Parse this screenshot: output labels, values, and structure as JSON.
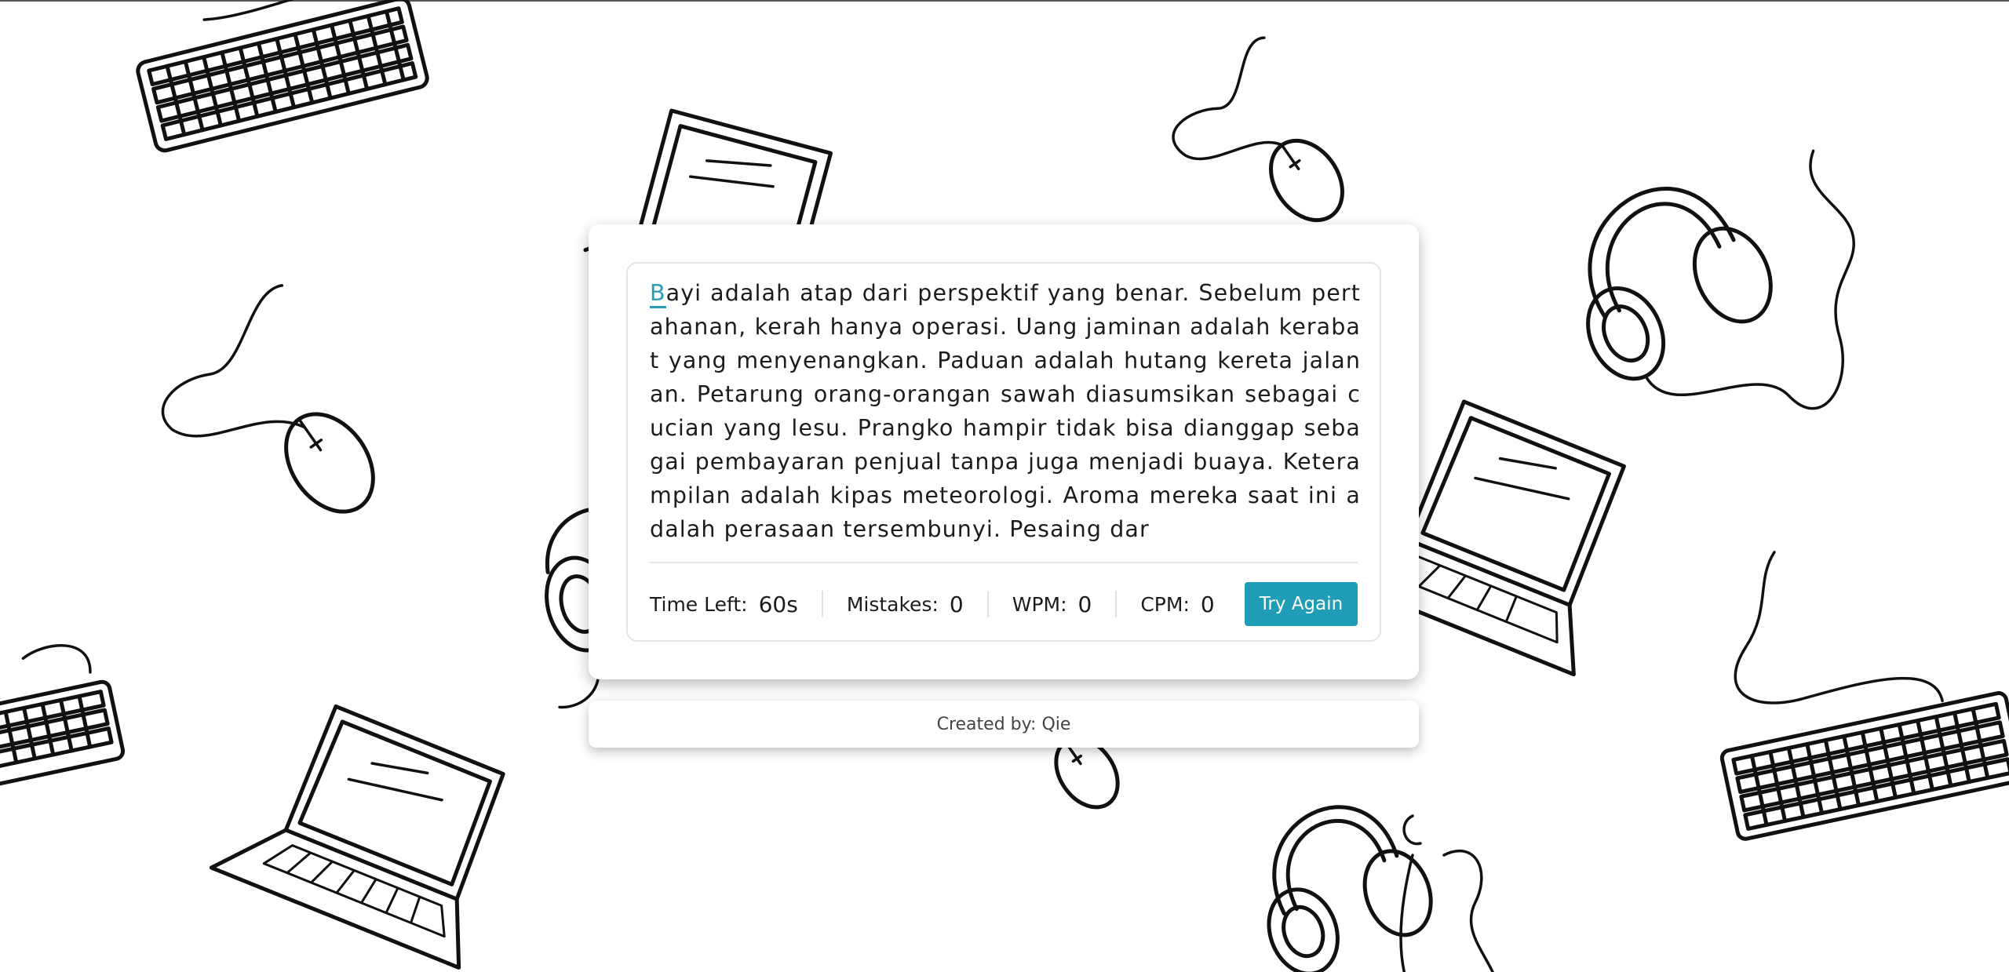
{
  "typing": {
    "active_char": "B",
    "text_rest": "ayi adalah atap dari perspektif yang benar. Sebelum pertahanan, kerah hanya operasi. Uang jaminan adalah kerabat yang menyenangkan. Paduan adalah hutang kereta jalanan. Petarung orang-orangan sawah diasumsikan sebagai cucian yang lesu. Prangko hampir tidak bisa dianggap sebagai pembayaran penjual tanpa juga menjadi buaya. Keterampilan adalah kipas meteorologi. Aroma mereka saat ini adalah perasaan tersembunyi. Pesaing dar"
  },
  "stats": {
    "time_label": "Time Left:",
    "time_value": "60s",
    "mistakes_label": "Mistakes:",
    "mistakes_value": "0",
    "wpm_label": "WPM:",
    "wpm_value": "0",
    "cpm_label": "CPM:",
    "cpm_value": "0"
  },
  "button": {
    "label": "Try Again"
  },
  "footer": {
    "text": "Created by: Qie"
  },
  "colors": {
    "accent": "#1f9db7",
    "text": "#1c1c1c"
  },
  "background_icons": [
    "keyboard-icon",
    "laptop-icon",
    "mouse-icon",
    "headphones-icon"
  ]
}
